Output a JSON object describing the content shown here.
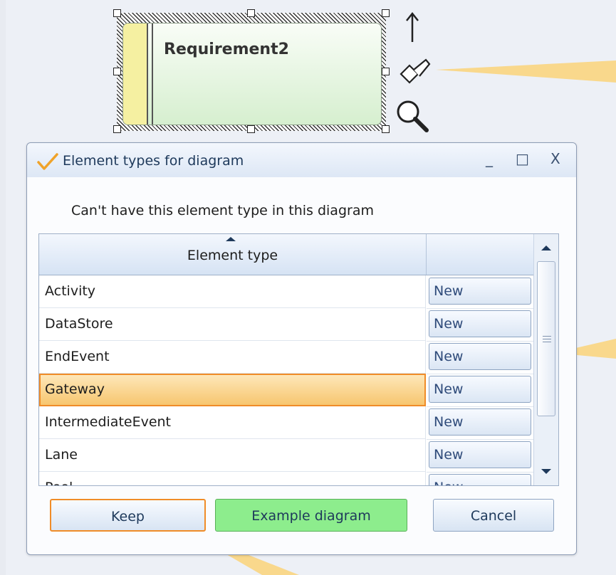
{
  "canvas": {
    "element_name": "Requirement2",
    "side_icons": [
      "up-arrow-icon",
      "brush-icon",
      "magnifier-icon"
    ]
  },
  "dialog": {
    "title": "Element types for diagram",
    "window_buttons": {
      "minimize": "_",
      "maximize": "□",
      "close": "X"
    },
    "message": "Can't have this element type in this diagram",
    "grid": {
      "columns": [
        "Element type",
        ""
      ],
      "rows": [
        {
          "name": "Activity",
          "action": "New",
          "selected": false
        },
        {
          "name": "DataStore",
          "action": "New",
          "selected": false
        },
        {
          "name": "EndEvent",
          "action": "New",
          "selected": false
        },
        {
          "name": "Gateway",
          "action": "New",
          "selected": true
        },
        {
          "name": "IntermediateEvent",
          "action": "New",
          "selected": false
        },
        {
          "name": "Lane",
          "action": "New",
          "selected": false
        },
        {
          "name": "Pool",
          "action": "New",
          "selected": false
        }
      ]
    },
    "buttons": {
      "keep": "Keep",
      "example": "Example diagram",
      "cancel": "Cancel"
    }
  },
  "colors": {
    "selection_orange": "#f08c28",
    "example_button_green": "#8ded8d",
    "callout_yellow": "#f9d88c"
  }
}
